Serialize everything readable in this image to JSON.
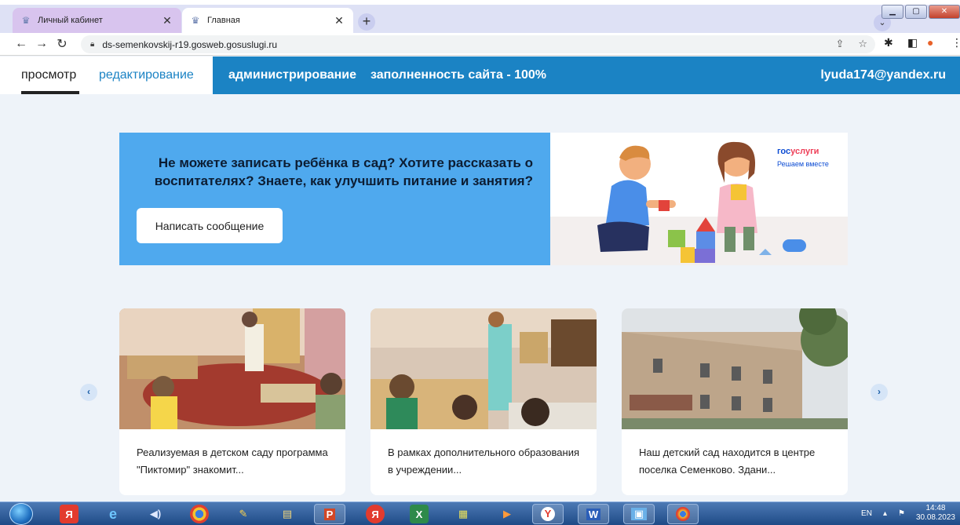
{
  "browser": {
    "tabs": [
      {
        "title": "Личный кабинет",
        "favicon": "coat-of-arms-icon"
      },
      {
        "title": "Главная",
        "favicon": "coat-of-arms-icon"
      }
    ],
    "url": "ds-semenkovskij-r19.gosweb.gosuslugi.ru"
  },
  "adminbar": {
    "view_mode": "просмотр",
    "edit_mode": "редактирование",
    "admin": "администрирование",
    "fill_status": "заполненность сайта - 100%",
    "user": "lyuda174@yandex.ru"
  },
  "banner": {
    "text": "Не можете записать ребёнка в сад? Хотите рассказать о воспитателях? Знаете, как улучшить питание и занятия?",
    "button": "Написать сообщение",
    "logo_part1": "гос",
    "logo_part2": "услуги",
    "tagline": "Решаем вместе",
    "bg_color": "#4fa9ee"
  },
  "news": [
    {
      "caption": "Реализуемая в детском саду программа \"Пиктомир\" знакомит..."
    },
    {
      "caption": "В рамках дополнительного образования в учреждении..."
    },
    {
      "caption": "Наш детский сад находится в центре поселка Семенково. Здани..."
    }
  ],
  "carousel": {
    "prev": "‹",
    "next": "›"
  },
  "taskbar": {
    "lang": "EN",
    "time": "14:48",
    "date": "30.08.2023"
  },
  "colors": {
    "accent": "#1b83c4",
    "page_bg": "#eef3f9"
  }
}
